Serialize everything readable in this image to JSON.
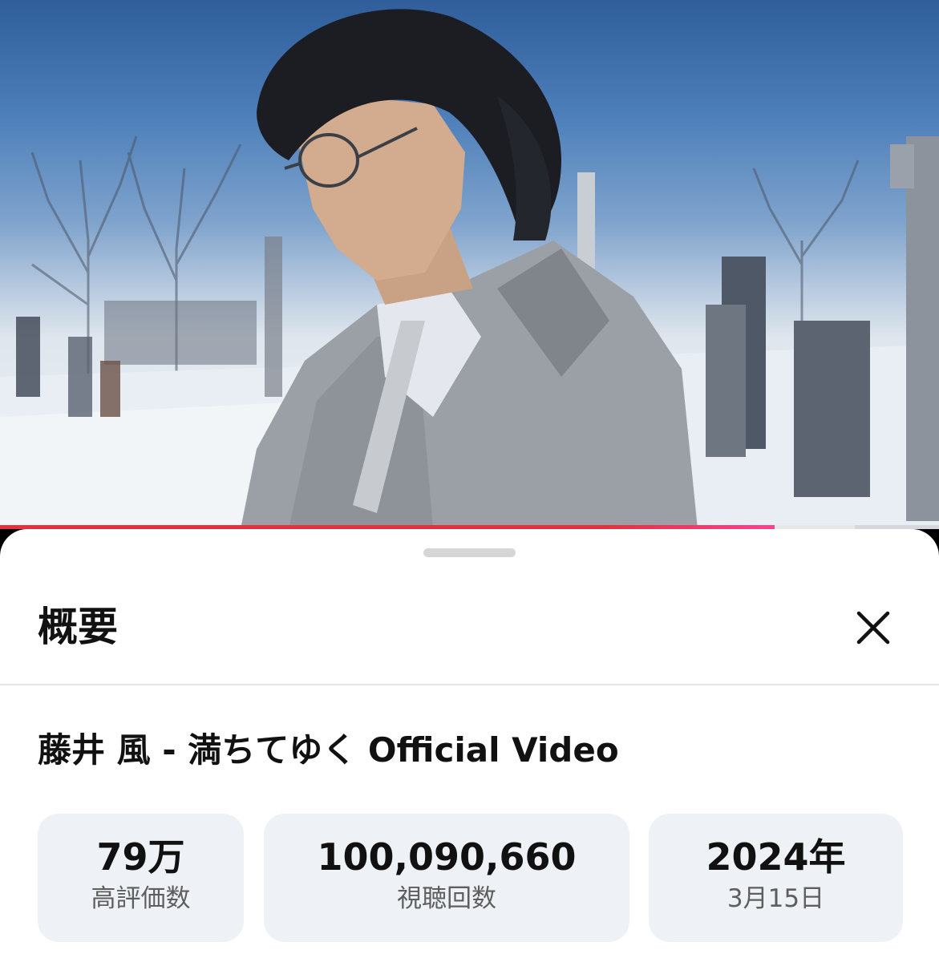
{
  "player": {
    "progress_fraction": 0.825,
    "buffered_fraction": 0.91,
    "progress_color": "#e8303c",
    "scene": "person in grey check suit and glasses in a snowy cemetery under blue sky"
  },
  "sheet": {
    "title": "概要",
    "close_icon": "close-icon"
  },
  "video": {
    "title": "藤井 風 - 満ちてゆく Official Video"
  },
  "stats": [
    {
      "value": "79万",
      "label": "高評価数"
    },
    {
      "value": "100,090,660",
      "label": "視聴回数"
    },
    {
      "value": "2024年",
      "label": "3月15日"
    }
  ],
  "colors": {
    "sheet_bg": "#ffffff",
    "card_bg": "#eef2f6",
    "text_primary": "#111111",
    "text_secondary": "#5e5e5e"
  }
}
